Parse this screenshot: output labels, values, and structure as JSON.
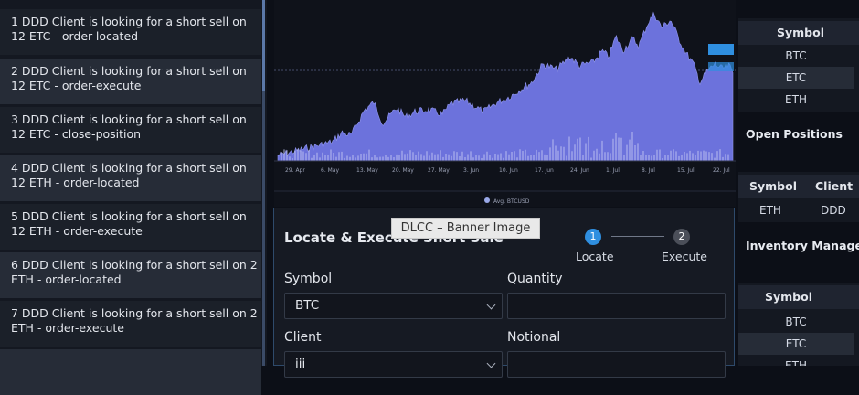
{
  "notifications": [
    "1 DDD Client is looking for a short sell on 12 ETC - order-located",
    "2 DDD Client is looking for a short sell on 12 ETC - order-execute",
    "3 DDD Client is looking for a short sell on 12 ETC - close-position",
    "4 DDD Client is looking for a short sell on 12 ETH - order-located",
    "5 DDD Client is looking for a short sell on 12 ETH - order-execute",
    "6 DDD Client is looking for a short sell on 2 ETH - order-located",
    "7 DDD Client is looking for a short sell on 2 ETH - order-execute"
  ],
  "chart": {
    "x_ticks": [
      "29. Apr",
      "6. May",
      "13. May",
      "20. May",
      "27. May",
      "3. Jun",
      "10. Jun",
      "17. Jun",
      "24. Jun",
      "1. Jul",
      "8. Jul",
      "15. Jul",
      "22. Jul"
    ],
    "legend": "Avg. BTCUSD",
    "colors": {
      "area": "#6c72dc",
      "volume": "#c5c9f2",
      "price_tag": "#2f8fe0"
    }
  },
  "locate": {
    "title": "Locate & Execute Short Sale",
    "steps": [
      {
        "number": "1",
        "label": "Locate",
        "active": true
      },
      {
        "number": "2",
        "label": "Execute",
        "active": false
      }
    ],
    "symbol_label": "Symbol",
    "symbol_value": "BTC",
    "quantity_label": "Quantity",
    "quantity_value": "",
    "client_label": "Client",
    "client_value": "iii",
    "notional_label": "Notional",
    "notional_value": ""
  },
  "banner": {
    "text": "DLCC – Banner Image"
  },
  "right_panel": {
    "symbols_header": "Symbol",
    "symbols": [
      "BTC",
      "ETC",
      "ETH"
    ],
    "open_positions_title": "Open Positions",
    "positions_headers": [
      "Symbol",
      "Client"
    ],
    "positions_rows": [
      [
        "ETH",
        "DDD"
      ]
    ],
    "inventory_title": "Inventory Manage",
    "inventory_header": "Symbol",
    "inventory_symbols": [
      "BTC",
      "ETC",
      "ETH"
    ]
  }
}
